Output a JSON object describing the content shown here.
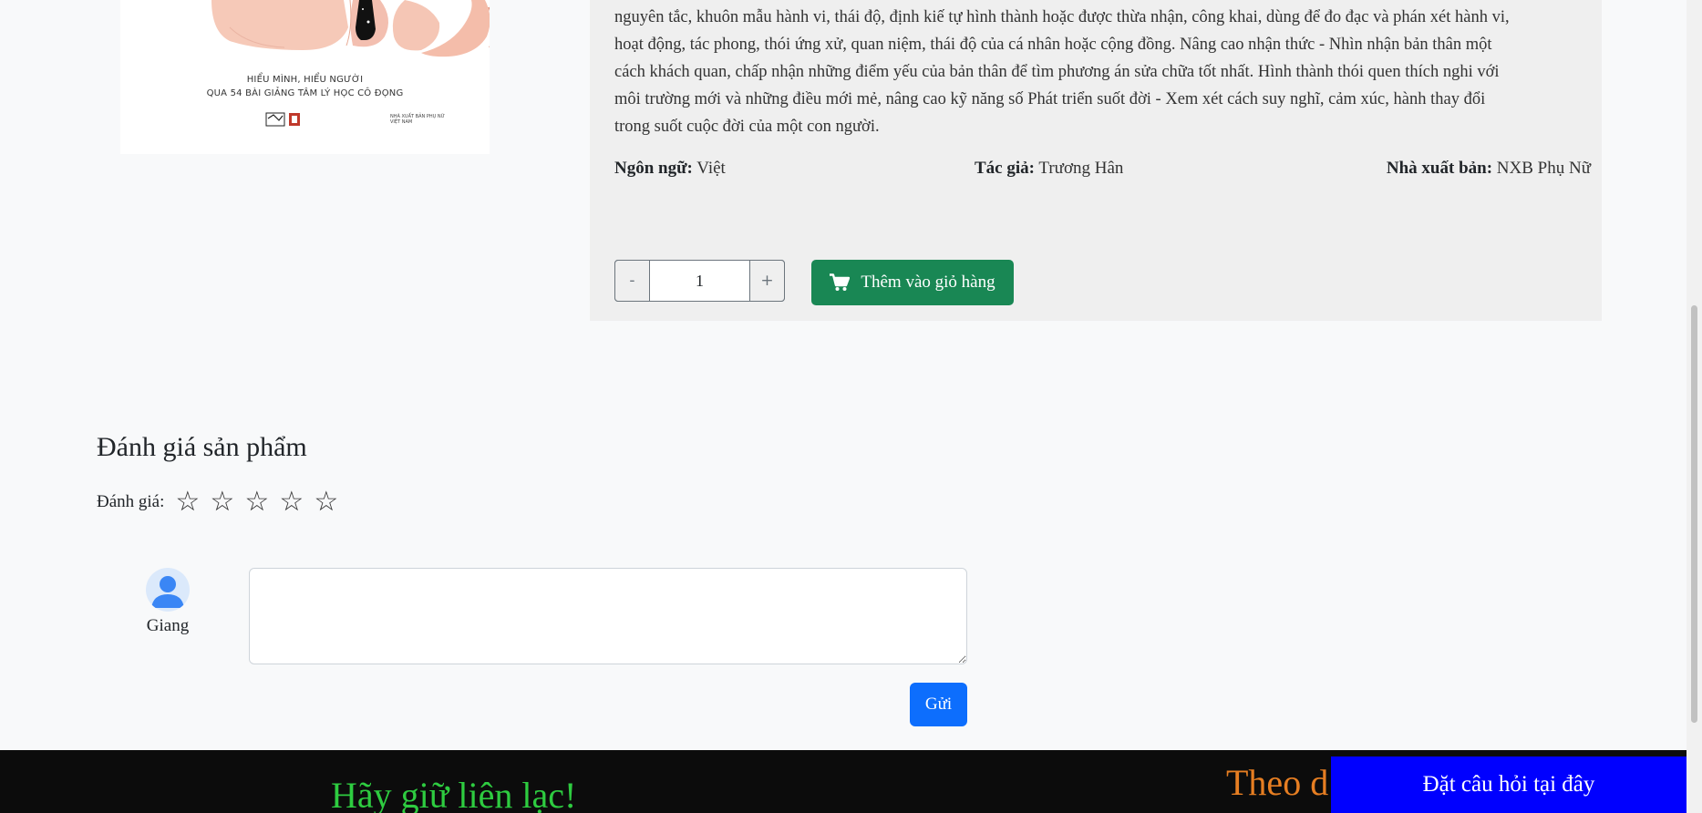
{
  "product": {
    "cover": {
      "subtitle_line1": "HIỂU MÌNH, HIỂU NGƯỜI",
      "subtitle_line2": "QUA 54 BÀI GIẢNG TÂM LÝ HỌC CÔ ĐỌNG",
      "publisher_mark": "NHÀ XUẤT BẢN PHỤ NỮ VIỆT NAM"
    },
    "description_lines": [
      "nguyên tắc, khuôn mẫu hành vi, thái độ, định kiế tự hình thành hoặc được thừa nhận, công khai, dùng để đo đạc và phán xét hành vi,",
      "hoạt động, tác phong, thói ứng xử, quan niệm, thái độ của cá nhân hoặc cộng đồng. Nâng cao nhận thức - Nhìn nhận bản thân một",
      "cách khách quan, chấp nhận những điểm yếu của bản thân để tìm phương án sửa chữa tốt nhất. Hình thành thói quen thích nghi với",
      "môi trường mới và những điều mới mẻ, nâng cao kỹ năng số Phát triển suốt đời - Xem xét cách suy nghĩ, cảm xúc, hành thay đổi",
      "trong suốt cuộc đời của một con người."
    ],
    "language_label": "Ngôn ngữ:",
    "language_value": "Việt",
    "author_label": "Tác giả:",
    "author_value": "Trương Hân",
    "publisher_label": "Nhà xuất bản:",
    "publisher_value": "NXB Phụ Nữ",
    "quantity": {
      "minus_label": "-",
      "value": "1",
      "plus_label": "+"
    },
    "add_to_cart_label": "Thêm vào giỏ hàng",
    "add_to_cart_icon": "cart-icon",
    "add_to_cart_color": "#198754"
  },
  "review": {
    "title": "Đánh giá sản phẩm",
    "rating_label": "Đánh giá:",
    "stars": [
      "☆",
      "☆",
      "☆",
      "☆",
      "☆"
    ],
    "rating_value": 0,
    "rating_max": 5,
    "user_name": "Giang",
    "comment_value": "",
    "send_label": "Gửi",
    "send_color": "#0d6efd"
  },
  "footer": {
    "contact_heading": "Hãy giữ liên lạc!",
    "follow_heading": "Theo d",
    "ask_button_label": "Đặt câu hỏi tại đây",
    "ask_button_color": "#0000ff"
  }
}
